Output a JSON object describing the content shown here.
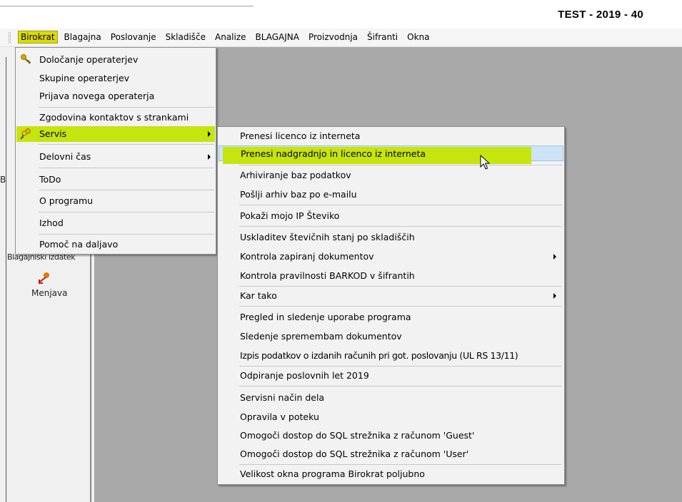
{
  "window": {
    "title": "TEST - 2019 - 40"
  },
  "menubar": {
    "items": [
      {
        "label": "Birokrat",
        "active": true
      },
      {
        "label": "Blagajna"
      },
      {
        "label": "Poslovanje"
      },
      {
        "label": "Skladišče"
      },
      {
        "label": "Analize"
      },
      {
        "label": "BLAGAJNA"
      },
      {
        "label": "Proizvodnja"
      },
      {
        "label": "Šifranti"
      },
      {
        "label": "Okna"
      }
    ]
  },
  "leftpane": {
    "stub_b": "B",
    "stub_text": "Blagajniški izdatek",
    "menjava_label": "Menjava"
  },
  "dropdown": {
    "items": [
      {
        "label": "Določanje operaterjev",
        "icon": "key-icon"
      },
      {
        "label": "Skupine operaterjev"
      },
      {
        "label": "Prijava novega operaterja"
      },
      {
        "label": "Zgodovina kontaktov s strankami"
      },
      {
        "label": "Servis",
        "icon": "keys-icon",
        "highlighted": true,
        "submenu": true
      },
      {
        "label": "Delovni čas",
        "submenu": true
      },
      {
        "label": "ToDo"
      },
      {
        "label": "O programu"
      },
      {
        "label": "Izhod"
      },
      {
        "label": "Pomoč na daljavo"
      }
    ]
  },
  "submenu": {
    "items": [
      {
        "label": "Prenesi licenco iz interneta"
      },
      {
        "label": "Prenesi nadgradnjo in licenco iz interneta",
        "hover": true,
        "highlighted": true
      },
      {
        "label": "Arhiviranje baz podatkov"
      },
      {
        "label": "Pošlji arhiv baz po e-mailu"
      },
      {
        "label": "Pokaži mojo IP Števiko"
      },
      {
        "label": "Uskladitev števičnih stanj po skladiščih"
      },
      {
        "label": "Kontrola zapiranj dokumentov",
        "submenu": true
      },
      {
        "label": "Kontrola pravilnosti BARKOD v šifrantih"
      },
      {
        "label": "Kar tako",
        "submenu": true
      },
      {
        "label": "Pregled in sledenje uporabe programa"
      },
      {
        "label": "Sledenje spremembam dokumentov"
      },
      {
        "label": "Izpis podatkov o izdanih računih pri got. poslovanju (UL RS 13/11)"
      },
      {
        "label": "Odpiranje poslovnih let 2019"
      },
      {
        "label": "Servisni način dela"
      },
      {
        "label": "Opravila v poteku"
      },
      {
        "label": "Omogoči dostop do SQL strežnika z računom 'Guest'"
      },
      {
        "label": "Omogoči dostop do SQL strežnika z računom 'User'"
      },
      {
        "label": "Velikost okna programa Birokrat poljubno"
      }
    ]
  },
  "colors": {
    "highlight": "#c6e40d",
    "hover": "#cde4f7",
    "workarea": "#a9a9a9"
  }
}
